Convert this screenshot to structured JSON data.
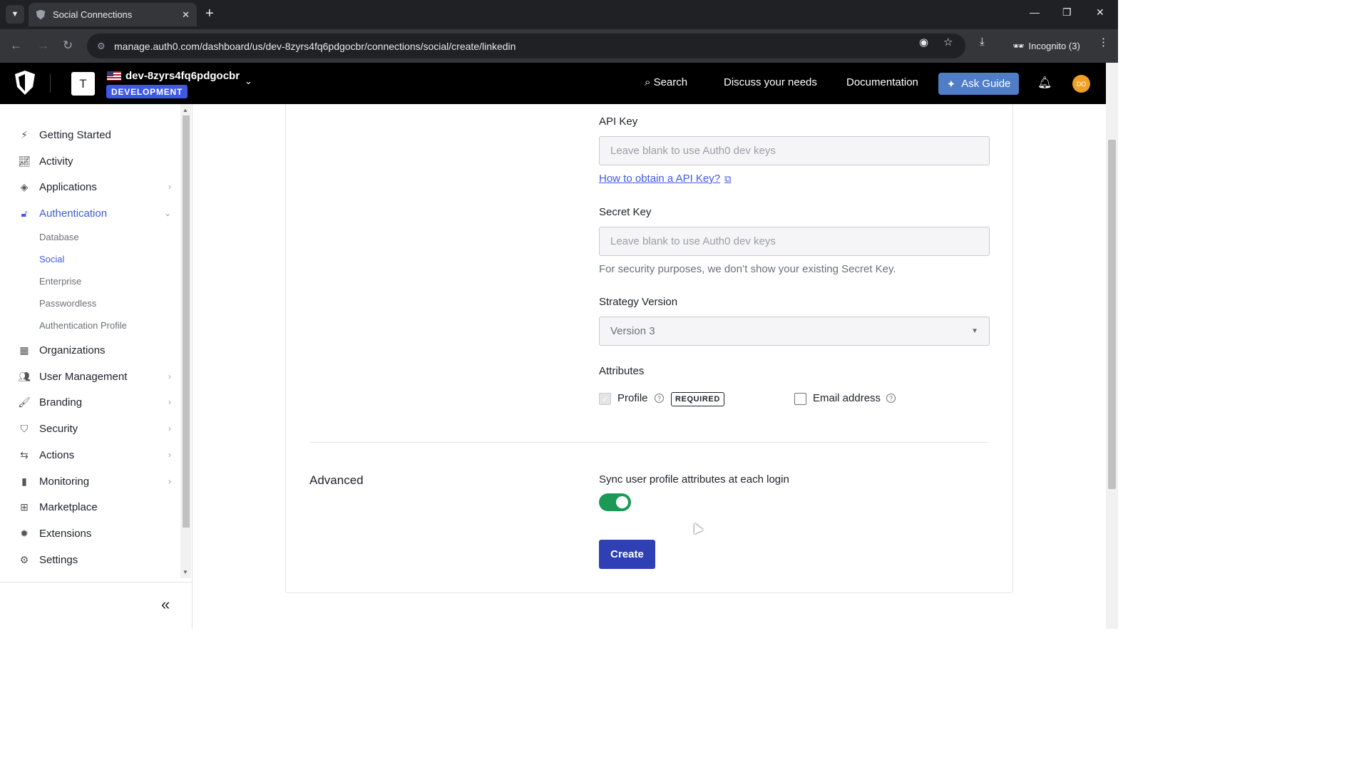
{
  "browser": {
    "tab_title": "Social Connections",
    "url": "manage.auth0.com/dashboard/us/dev-8zyrs4fq6pdgocbr/connections/social/create/linkedin",
    "incognito_label": "Incognito (3)"
  },
  "header": {
    "tenant_initial": "T",
    "tenant_name": "dev-8zyrs4fq6pdgocbr",
    "environment": "DEVELOPMENT",
    "search": "Search",
    "discuss": "Discuss your needs",
    "documentation": "Documentation",
    "ask_guide": "Ask Guide",
    "user_initials": "DO"
  },
  "sidebar": {
    "items": [
      {
        "label": "Getting Started",
        "icon": "bolt-icon"
      },
      {
        "label": "Activity",
        "icon": "chart-line-icon"
      },
      {
        "label": "Applications",
        "icon": "layers-icon"
      },
      {
        "label": "Authentication",
        "icon": "lock-icon"
      },
      {
        "label": "Organizations",
        "icon": "building-icon"
      },
      {
        "label": "User Management",
        "icon": "users-icon"
      },
      {
        "label": "Branding",
        "icon": "brush-icon"
      },
      {
        "label": "Security",
        "icon": "shield-icon"
      },
      {
        "label": "Actions",
        "icon": "flow-icon"
      },
      {
        "label": "Monitoring",
        "icon": "bar-chart-icon"
      },
      {
        "label": "Marketplace",
        "icon": "grid-plus-icon"
      },
      {
        "label": "Extensions",
        "icon": "gear-dots-icon"
      },
      {
        "label": "Settings",
        "icon": "gear-icon"
      }
    ],
    "auth_sub": [
      "Database",
      "Social",
      "Enterprise",
      "Passwordless",
      "Authentication Profile"
    ]
  },
  "form": {
    "api_key_label": "API Key",
    "api_key_placeholder": "Leave blank to use Auth0 dev keys",
    "api_key_link": "How to obtain a API Key?",
    "secret_key_label": "Secret Key",
    "secret_key_placeholder": "Leave blank to use Auth0 dev keys",
    "secret_help": "For security purposes, we don’t show your existing Secret Key.",
    "strategy_label": "Strategy Version",
    "strategy_value": "Version 3",
    "attributes_label": "Attributes",
    "attr_profile": "Profile",
    "attr_required": "REQUIRED",
    "attr_email": "Email address",
    "advanced_title": "Advanced",
    "sync_label": "Sync user profile attributes at each login",
    "sync_enabled": true,
    "create_label": "Create"
  },
  "colors": {
    "accent": "#3f59e4",
    "toggle_on": "#1b9a57",
    "primary_button": "#2f40b4"
  }
}
